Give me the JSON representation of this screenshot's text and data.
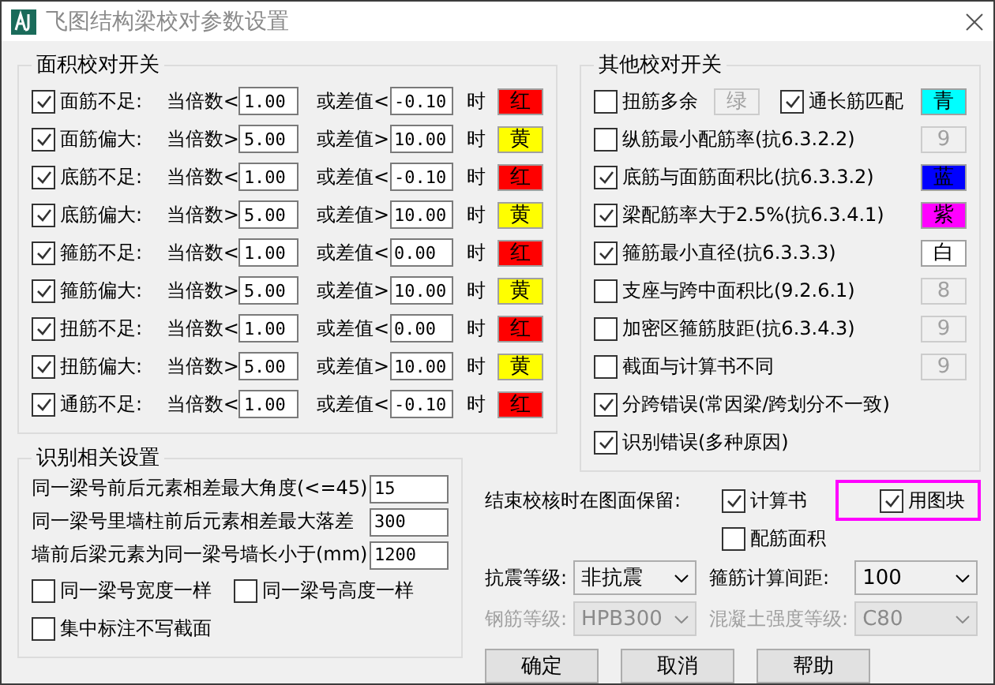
{
  "window": {
    "title": "飞图结构梁校对参数设置"
  },
  "area_checks": {
    "title": "面积校对开关",
    "rows": [
      {
        "checked": true,
        "label": "面筋不足:",
        "ratio_label": "当倍数<",
        "ratio_value": "1.00",
        "diff_label": "或差值<",
        "diff_value": "-0.10",
        "unit": "时",
        "swatch": {
          "text": "红",
          "color": "#ff0000"
        }
      },
      {
        "checked": true,
        "label": "面筋偏大:",
        "ratio_label": "当倍数>",
        "ratio_value": "5.00",
        "diff_label": "或差值>",
        "diff_value": "10.00",
        "unit": "时",
        "swatch": {
          "text": "黄",
          "color": "#ffff00"
        }
      },
      {
        "checked": true,
        "label": "底筋不足:",
        "ratio_label": "当倍数<",
        "ratio_value": "1.00",
        "diff_label": "或差值<",
        "diff_value": "-0.10",
        "unit": "时",
        "swatch": {
          "text": "红",
          "color": "#ff0000"
        }
      },
      {
        "checked": true,
        "label": "底筋偏大:",
        "ratio_label": "当倍数>",
        "ratio_value": "5.00",
        "diff_label": "或差值>",
        "diff_value": "10.00",
        "unit": "时",
        "swatch": {
          "text": "黄",
          "color": "#ffff00"
        }
      },
      {
        "checked": true,
        "label": "箍筋不足:",
        "ratio_label": "当倍数<",
        "ratio_value": "1.00",
        "diff_label": "或差值<",
        "diff_value": "0.00",
        "unit": "时",
        "swatch": {
          "text": "红",
          "color": "#ff0000"
        }
      },
      {
        "checked": true,
        "label": "箍筋偏大:",
        "ratio_label": "当倍数>",
        "ratio_value": "5.00",
        "diff_label": "或差值>",
        "diff_value": "10.00",
        "unit": "时",
        "swatch": {
          "text": "黄",
          "color": "#ffff00"
        }
      },
      {
        "checked": true,
        "label": "扭筋不足:",
        "ratio_label": "当倍数<",
        "ratio_value": "1.00",
        "diff_label": "或差值<",
        "diff_value": "0.00",
        "unit": "时",
        "swatch": {
          "text": "红",
          "color": "#ff0000"
        }
      },
      {
        "checked": true,
        "label": "扭筋偏大:",
        "ratio_label": "当倍数>",
        "ratio_value": "5.00",
        "diff_label": "或差值>",
        "diff_value": "10.00",
        "unit": "时",
        "swatch": {
          "text": "黄",
          "color": "#ffff00"
        }
      },
      {
        "checked": true,
        "label": "通筋不足:",
        "ratio_label": "当倍数<",
        "ratio_value": "1.00",
        "diff_label": "或差值<",
        "diff_value": "-0.10",
        "unit": "时",
        "swatch": {
          "text": "红",
          "color": "#ff0000"
        }
      }
    ]
  },
  "other_checks": {
    "title": "其他校对开关",
    "rows": [
      {
        "kind": "pair",
        "checked": false,
        "label": "扭筋多余",
        "swatch": {
          "disabled": true,
          "text": "绿"
        },
        "second": {
          "checked": true,
          "label": "通长筋匹配",
          "swatch": {
            "disabled": false,
            "text": "青",
            "color": "#00ffff"
          }
        }
      },
      {
        "kind": "single",
        "checked": false,
        "label": "纵筋最小配筋率(抗6.3.2.2)",
        "swatch": {
          "disabled": true,
          "text": "9"
        }
      },
      {
        "kind": "single",
        "checked": true,
        "label": "底筋与面筋面积比(抗6.3.3.2)",
        "swatch": {
          "disabled": false,
          "text": "蓝",
          "color": "#0000ff"
        }
      },
      {
        "kind": "single",
        "checked": true,
        "label": "梁配筋率大于2.5%(抗6.3.4.1)",
        "swatch": {
          "disabled": false,
          "text": "紫",
          "color": "#ff00ff"
        }
      },
      {
        "kind": "single",
        "checked": true,
        "label": "箍筋最小直径(抗6.3.3.3)",
        "swatch": {
          "disabled": false,
          "text": "白",
          "color": "#ffffff"
        }
      },
      {
        "kind": "single",
        "checked": false,
        "label": "支座与跨中面积比(9.2.6.1)",
        "swatch": {
          "disabled": true,
          "text": "8"
        }
      },
      {
        "kind": "single",
        "checked": false,
        "label": "加密区箍筋肢距(抗6.3.4.3)",
        "swatch": {
          "disabled": true,
          "text": "9"
        }
      },
      {
        "kind": "single",
        "checked": false,
        "label": "截面与计算书不同",
        "swatch": {
          "disabled": true,
          "text": "9"
        }
      },
      {
        "kind": "single",
        "checked": true,
        "label": "分跨错误(常因梁/跨划分不一致)"
      },
      {
        "kind": "single",
        "checked": true,
        "label": "识别错误(多种原因)"
      }
    ]
  },
  "recognition": {
    "title": "识别相关设置",
    "fields": [
      {
        "label": "同一梁号前后元素相差最大角度(<=45)",
        "value": "15"
      },
      {
        "label": "同一梁号里墙柱前后元素相差最大落差",
        "value": "300"
      },
      {
        "label": "墙前后梁元素为同一梁号墙长小于(mm)",
        "value": "1200"
      }
    ],
    "checkbox_rows": [
      [
        {
          "label": "同一梁号宽度一样",
          "checked": false
        },
        {
          "label": "同一梁号高度一样",
          "checked": false
        }
      ],
      [
        {
          "label": "集中标注不写截面",
          "checked": false
        }
      ]
    ]
  },
  "keep": {
    "label": "结束校核时在图面保留:",
    "options": [
      {
        "label": "计算书",
        "checked": true,
        "highlighted": false
      },
      {
        "label": "用图块",
        "checked": true,
        "highlighted": true
      },
      {
        "label": "配筋面积",
        "checked": false,
        "highlighted": false
      }
    ]
  },
  "selects": [
    {
      "label": "抗震等级:",
      "value": "非抗震",
      "disabled": false
    },
    {
      "label": "箍筋计算间距:",
      "value": "100",
      "disabled": false
    },
    {
      "label": "钢筋等级:",
      "value": "HPB300",
      "disabled": true
    },
    {
      "label": "混凝土强度等级:",
      "value": "C80",
      "disabled": true
    }
  ],
  "buttons": [
    "确定",
    "取消",
    "帮助"
  ]
}
